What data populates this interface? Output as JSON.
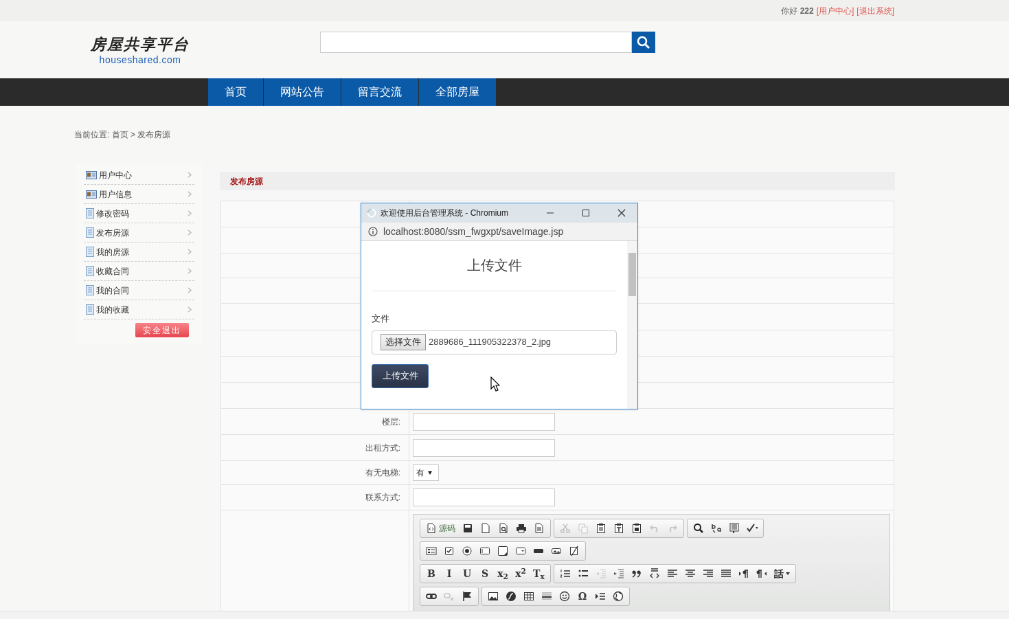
{
  "top_bar": {
    "greeting": "你好 **222**",
    "links": [
      "[用户中心]",
      "[退出系统]"
    ]
  },
  "header": {
    "logo_title": "房屋共享平台",
    "logo_domain": "houseshared.com"
  },
  "nav": [
    {
      "label": "首页"
    },
    {
      "label": "网站公告"
    },
    {
      "label": "留言交流"
    },
    {
      "label": "全部房屋"
    }
  ],
  "breadcrumb": "当前位置: 首页 > 发布房源",
  "sidebar": {
    "items": [
      {
        "label": "用户中心",
        "kind": "card"
      },
      {
        "label": "用户信息",
        "kind": "card"
      },
      {
        "label": "修改密码",
        "kind": "doc"
      },
      {
        "label": "发布房源",
        "kind": "doc"
      },
      {
        "label": "我的房源",
        "kind": "doc"
      },
      {
        "label": "收藏合同",
        "kind": "doc"
      },
      {
        "label": "我的合同",
        "kind": "doc"
      },
      {
        "label": "我的收藏",
        "kind": "doc"
      }
    ],
    "logout": "安全退出"
  },
  "panel": {
    "title": "发布房源"
  },
  "form": {
    "rows": [
      {
        "label": "楼层:",
        "kind": "text"
      },
      {
        "label": "出租方式:",
        "kind": "text"
      },
      {
        "label": "有无电梯:",
        "kind": "select",
        "value": "有"
      },
      {
        "label": "联系方式:",
        "kind": "text"
      }
    ]
  },
  "editor": {
    "toolbar_rows": [
      [
        [
          {
            "kind": "source",
            "label": "源码"
          },
          {
            "kind": "save"
          },
          {
            "kind": "newpage"
          },
          {
            "kind": "preview"
          },
          {
            "kind": "print"
          },
          {
            "kind": "templates"
          }
        ],
        [
          {
            "kind": "cut",
            "disabled": true
          },
          {
            "kind": "copy",
            "disabled": true
          },
          {
            "kind": "paste"
          },
          {
            "kind": "pastetext"
          },
          {
            "kind": "pasteword"
          },
          {
            "kind": "undo",
            "disabled": true
          },
          {
            "kind": "redo",
            "disabled": true
          }
        ],
        [
          {
            "kind": "find"
          },
          {
            "kind": "replace"
          },
          {
            "kind": "selectall"
          },
          {
            "kind": "spellcheck"
          }
        ]
      ],
      [
        [
          {
            "kind": "form"
          },
          {
            "kind": "checkbox"
          },
          {
            "kind": "radio"
          },
          {
            "kind": "textfield"
          },
          {
            "kind": "textarea"
          },
          {
            "kind": "select"
          },
          {
            "kind": "button"
          },
          {
            "kind": "imagebutton"
          },
          {
            "kind": "hiddenfield"
          }
        ]
      ],
      [
        [
          {
            "kind": "text",
            "label": "B"
          },
          {
            "kind": "text",
            "label": "I"
          },
          {
            "kind": "text",
            "label": "U"
          },
          {
            "kind": "text",
            "label": "S"
          },
          {
            "kind": "text",
            "label": "x$_{2}$"
          },
          {
            "kind": "text",
            "label": "x$^{2}$"
          },
          {
            "kind": "text",
            "label": "T$_{x}$"
          }
        ],
        [
          {
            "kind": "numbered"
          },
          {
            "kind": "bulleted"
          },
          {
            "kind": "outdent",
            "disabled": true
          },
          {
            "kind": "indent"
          },
          {
            "kind": "blockquote"
          },
          {
            "kind": "creatediv"
          },
          {
            "kind": "alignleft"
          },
          {
            "kind": "aligncenter"
          },
          {
            "kind": "alignright"
          },
          {
            "kind": "justify"
          },
          {
            "kind": "ltr"
          },
          {
            "kind": "rtl"
          },
          {
            "kind": "language",
            "label": "話"
          }
        ]
      ],
      [
        [
          {
            "kind": "link"
          },
          {
            "kind": "unlink",
            "disabled": true
          },
          {
            "kind": "anchor"
          }
        ],
        [
          {
            "kind": "image"
          },
          {
            "kind": "flash"
          },
          {
            "kind": "table"
          },
          {
            "kind": "hr"
          },
          {
            "kind": "smiley"
          },
          {
            "kind": "text",
            "label": "Ω"
          },
          {
            "kind": "pagebreak"
          },
          {
            "kind": "iframe"
          }
        ]
      ]
    ]
  },
  "popup": {
    "title": "欢迎使用后台管理系统 - Chromium",
    "url": "localhost:8080/ssm_fwgxpt/saveImage.jsp",
    "heading": "上传文件",
    "field_label": "文件",
    "choose_button": "选择文件",
    "file_name": "2889686_111905322378_2.jpg",
    "submit": "上传文件"
  }
}
